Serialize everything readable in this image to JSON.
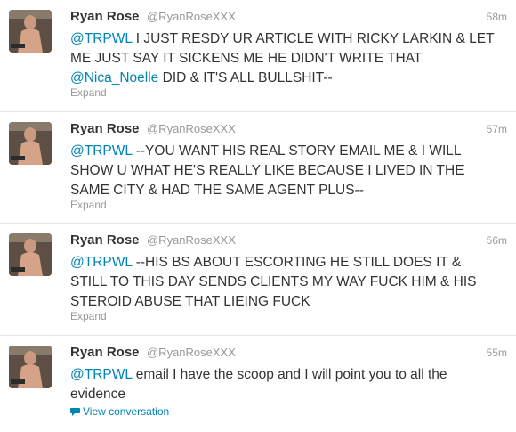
{
  "tweets": [
    {
      "name": "Ryan Rose",
      "handle": "@RyanRoseXXX",
      "time": "58m",
      "mention": "@TRPWL",
      "text_a": " I JUST RESDY UR ARTICLE WITH RICKY LARKIN & LET ME JUST SAY IT SICKENS ME HE DIDN'T WRITE THAT ",
      "mention2": "@Nica_Noelle",
      "text_b": " DID & IT'S ALL BULLSHIT--",
      "action": "Expand"
    },
    {
      "name": "Ryan Rose",
      "handle": "@RyanRoseXXX",
      "time": "57m",
      "mention": "@TRPWL",
      "text_a": " --YOU WANT HIS REAL STORY EMAIL ME & I WILL SHOW U WHAT HE'S REALLY LIKE BECAUSE I LIVED IN THE SAME CITY & HAD THE SAME AGENT PLUS--",
      "action": "Expand"
    },
    {
      "name": "Ryan Rose",
      "handle": "@RyanRoseXXX",
      "time": "56m",
      "mention": "@TRPWL",
      "text_a": " --HIS BS ABOUT ESCORTING HE STILL DOES IT & STILL TO THIS DAY SENDS CLIENTS MY WAY FUCK HIM & HIS STEROID ABUSE THAT LIEING FUCK",
      "action": "Expand"
    },
    {
      "name": "Ryan Rose",
      "handle": "@RyanRoseXXX",
      "time": "55m",
      "mention": "@TRPWL",
      "text_a": " email I have the scoop and I will point you to all the evidence",
      "action": "View conversation"
    }
  ],
  "colors": {
    "link": "#0084b4",
    "name": "#333333",
    "meta": "#999999",
    "divider": "#e1e8ed"
  },
  "icons": {
    "avatar": "profile-photo",
    "conversation": "speech-bubble-icon"
  }
}
